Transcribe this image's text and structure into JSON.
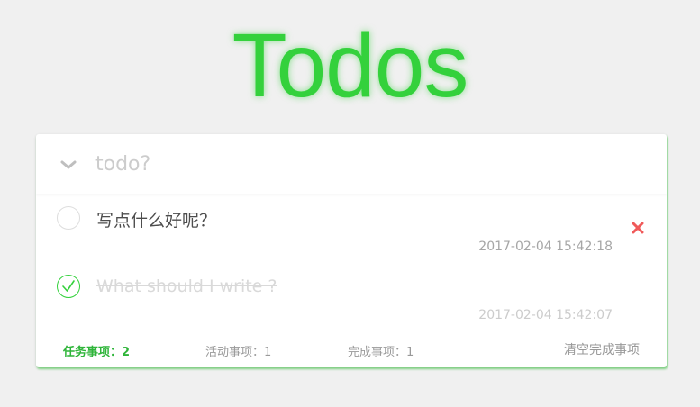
{
  "header": {
    "title": "Todos"
  },
  "new_todo": {
    "placeholder": "todo?",
    "toggle_icon": "chevron-down-icon"
  },
  "todos": [
    {
      "text": "写点什么好呢？",
      "time": "2017-02-04 15:42:18",
      "completed": false,
      "delete_icon": "close-icon"
    },
    {
      "text": "What should I write ?",
      "time": "2017-02-04 15:42:07",
      "completed": true
    }
  ],
  "footer": {
    "all": {
      "label": "任务事项：",
      "count": "2"
    },
    "active": {
      "label": "活动事项：",
      "count": "1"
    },
    "completed": {
      "label": "完成事项：",
      "count": "1"
    },
    "clear_label": "清空完成事项"
  },
  "colors": {
    "accent": "#34d13c",
    "delete": "#f05a5a",
    "background": "#f0f0f0"
  }
}
